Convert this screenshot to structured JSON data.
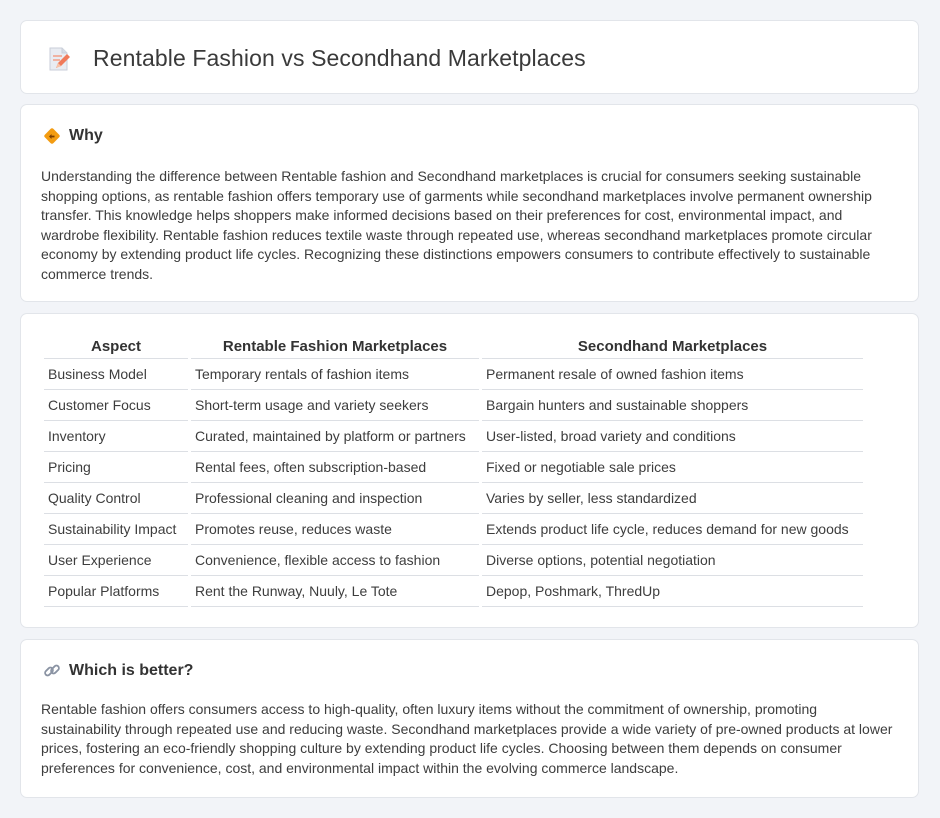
{
  "page": {
    "title": "Rentable Fashion vs Secondhand Marketplaces",
    "title_icon": "document-pencil-icon"
  },
  "why": {
    "icon": "diamond-arrows-icon",
    "heading": "Why",
    "text": "Understanding the difference between Rentable fashion and Secondhand marketplaces is crucial for consumers seeking sustainable shopping options, as rentable fashion offers temporary use of garments while secondhand marketplaces involve permanent ownership transfer. This knowledge helps shoppers make informed decisions based on their preferences for cost, environmental impact, and wardrobe flexibility. Rentable fashion reduces textile waste through repeated use, whereas secondhand marketplaces promote circular economy by extending product life cycles. Recognizing these distinctions empowers consumers to contribute effectively to sustainable commerce trends."
  },
  "table": {
    "headers": [
      "Aspect",
      "Rentable Fashion Marketplaces",
      "Secondhand Marketplaces"
    ],
    "rows": [
      [
        "Business Model",
        "Temporary rentals of fashion items",
        "Permanent resale of owned fashion items"
      ],
      [
        "Customer Focus",
        "Short-term usage and variety seekers",
        "Bargain hunters and sustainable shoppers"
      ],
      [
        "Inventory",
        "Curated, maintained by platform or partners",
        "User-listed, broad variety and conditions"
      ],
      [
        "Pricing",
        "Rental fees, often subscription-based",
        "Fixed or negotiable sale prices"
      ],
      [
        "Quality Control",
        "Professional cleaning and inspection",
        "Varies by seller, less standardized"
      ],
      [
        "Sustainability Impact",
        "Promotes reuse, reduces waste",
        "Extends product life cycle, reduces demand for new goods"
      ],
      [
        "User Experience",
        "Convenience, flexible access to fashion",
        "Diverse options, potential negotiation"
      ],
      [
        "Popular Platforms",
        "Rent the Runway, Nuuly, Le Tote",
        "Depop, Poshmark, ThredUp"
      ]
    ]
  },
  "better": {
    "icon": "link-icon",
    "heading": "Which is better?",
    "text": "Rentable fashion offers consumers access to high-quality, often luxury items without the commitment of ownership, promoting sustainability through repeated use and reducing waste. Secondhand marketplaces provide a wide variety of pre-owned products at lower prices, fostering an eco-friendly shopping culture by extending product life cycles. Choosing between them depends on consumer preferences for convenience, cost, and environmental impact within the evolving commerce landscape."
  },
  "colors": {
    "background": "#f2f4f8",
    "card": "#ffffff",
    "border": "#e2e5ea",
    "accent_orange": "#f39c12",
    "accent_pink": "#f08080"
  }
}
